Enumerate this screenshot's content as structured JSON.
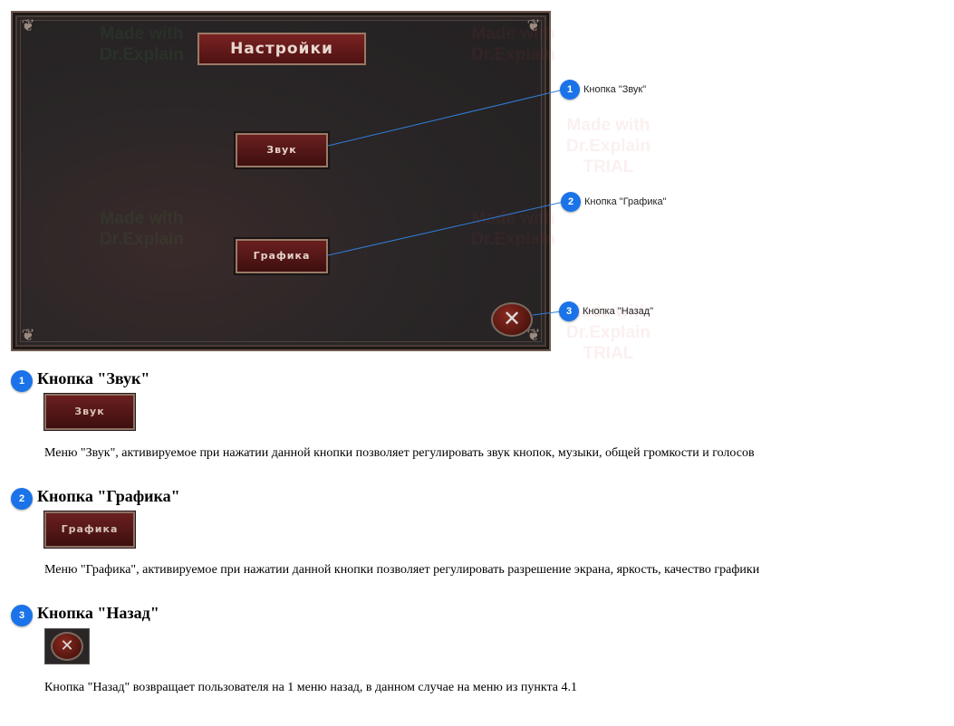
{
  "game_screen": {
    "title": "Настройки",
    "sound_button": "Звук",
    "graphics_button": "Графика",
    "close_symbol": "✕"
  },
  "callouts": [
    {
      "number": "1",
      "label": "Кнопка \"Звук\""
    },
    {
      "number": "2",
      "label": "Кнопка \"Графика\""
    },
    {
      "number": "3",
      "label": "Кнопка \"Назад\""
    }
  ],
  "watermark": {
    "line1": "Made with",
    "line2": "Dr.Explain",
    "line3": "TRIAL"
  },
  "sections": [
    {
      "number": "1",
      "heading": "Кнопка \"Звук\"",
      "thumb_label": "Звук",
      "description": "Меню \"Звук\", активируемое при нажатии данной кнопки позволяет регулировать звук кнопок, музыки, общей громкости и голосов"
    },
    {
      "number": "2",
      "heading": "Кнопка \"Графика\"",
      "thumb_label": "Графика",
      "description": "Меню \"Графика\", активируемое при нажатии данной кнопки позволяет регулировать разрешение экрана, яркость, качество графики"
    },
    {
      "number": "3",
      "heading": "Кнопка \"Назад\"",
      "thumb_label": "✕",
      "description": "Кнопка \"Назад\" возвращает пользователя на 1 меню назад, в данном случае на меню из пункта 4.1"
    }
  ],
  "colors": {
    "callout_blue": "#1a73e8",
    "button_red": "#6b1f1f",
    "panel_dark": "#2a2526"
  }
}
